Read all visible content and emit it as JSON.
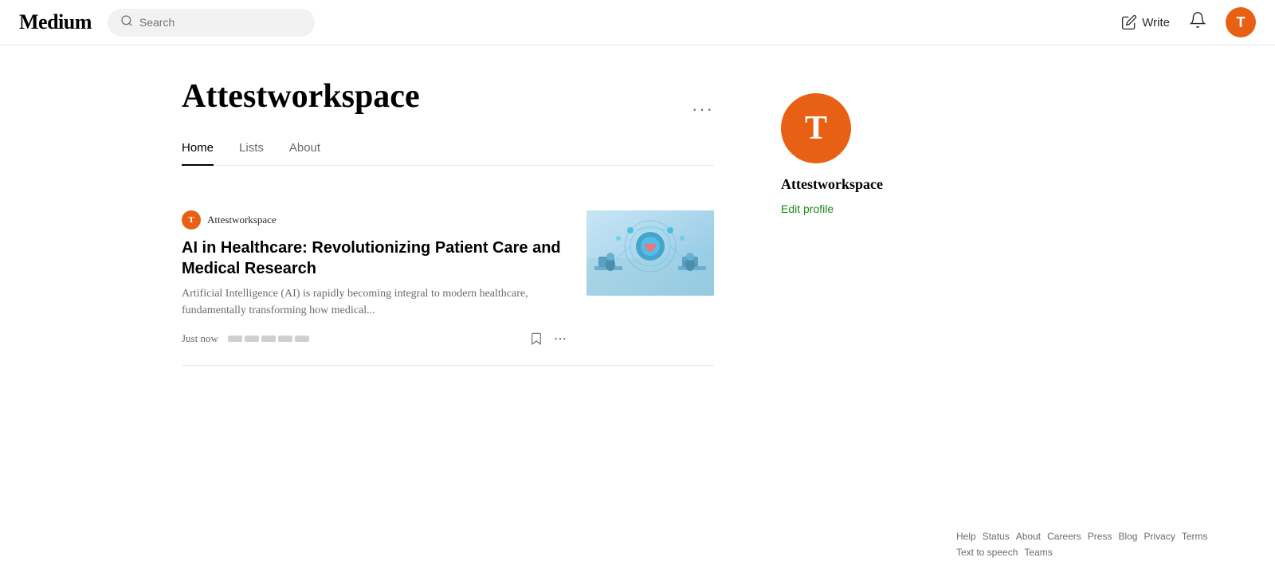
{
  "header": {
    "logo": "Medium",
    "search_placeholder": "Search",
    "write_label": "Write",
    "notification_icon": "🔔",
    "avatar_letter": "T"
  },
  "profile": {
    "name": "Attestworkspace",
    "more_icon": "···"
  },
  "tabs": [
    {
      "label": "Home",
      "active": true
    },
    {
      "label": "Lists",
      "active": false
    },
    {
      "label": "About",
      "active": false
    }
  ],
  "article": {
    "author_letter": "T",
    "author_name": "Attestworkspace",
    "title": "AI in Healthcare: Revolutionizing Patient Care and Medical Research",
    "excerpt": "Artificial Intelligence (AI) is rapidly becoming integral to modern healthcare, fundamentally transforming how medical...",
    "time": "Just now"
  },
  "sidebar": {
    "avatar_letter": "T",
    "name": "Attestworkspace",
    "edit_profile_label": "Edit profile"
  },
  "footer": {
    "links": [
      "Help",
      "Status",
      "About",
      "Careers",
      "Press",
      "Blog",
      "Privacy",
      "Terms",
      "Text to speech",
      "Teams"
    ]
  }
}
